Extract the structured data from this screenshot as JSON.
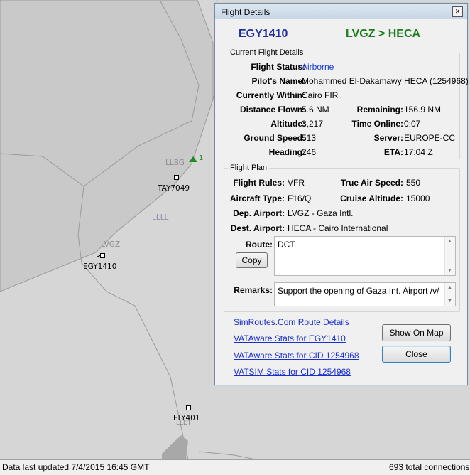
{
  "map": {
    "labels": {
      "llbg": "LLBG",
      "taycall": "TAY7049",
      "llll": "LLLL",
      "lvgz": "LVGZ",
      "egycall": "EGY1410",
      "elycall": "ELY401",
      "llet": "LLET",
      "traffic_count": "1"
    },
    "colors": {
      "land": "#c9c9c9",
      "sea": "#d7d7d7",
      "fir_line": "#9a9a9a",
      "traffic": "#1f8a1f"
    }
  },
  "dialog": {
    "title": "Flight Details",
    "close_glyph": "✕",
    "callsign": "EGY1410",
    "route": "LVGZ > HECA",
    "current": {
      "legend": "Current Flight Details",
      "status_label": "Flight Status:",
      "status_value": "Airborne",
      "pilot_label": "Pilot's Name:",
      "pilot_value": "Mohammed El-Dakamawy HECA (1254968)",
      "within_label": "Currently Within:",
      "within_value": "Cairo FIR",
      "dist_label": "Distance Flown:",
      "dist_value": "5.6 NM",
      "remain_label": "Remaining:",
      "remain_value": "156.9 NM",
      "alt_label": "Altitude:",
      "alt_value": "3,217",
      "online_label": "Time Online:",
      "online_value": "0:07",
      "gs_label": "Ground Speed:",
      "gs_value": "513",
      "server_label": "Server:",
      "server_value": "EUROPE-CC",
      "hdg_label": "Heading:",
      "hdg_value": "246",
      "eta_label": "ETA:",
      "eta_value": "17:04 Z"
    },
    "plan": {
      "legend": "Flight Plan",
      "rules_label": "Flight Rules:",
      "rules_value": "VFR",
      "tas_label": "True Air Speed:",
      "tas_value": "550",
      "type_label": "Aircraft Type:",
      "type_value": "F16/Q",
      "cruise_label": "Cruise Altitude:",
      "cruise_value": "15000",
      "dep_label": "Dep. Airport:",
      "dep_value": "LVGZ - Gaza Intl.",
      "dest_label": "Dest. Airport:",
      "dest_value": "HECA - Cairo International",
      "route_label": "Route:",
      "route_value": "DCT",
      "copy_label": "Copy",
      "remarks_label": "Remarks:",
      "remarks_value": "Support the opening of Gaza Int. Airport /v/"
    },
    "links": {
      "simroutes": "SimRoutes.Com Route Details",
      "vataware_callsign": "VATAware Stats for EGY1410",
      "vataware_cid": "VATAware Stats for CID 1254968",
      "vatsim_cid": "VATSIM Stats for CID 1254968"
    },
    "buttons": {
      "show_on_map": "Show On Map",
      "close": "Close"
    }
  },
  "status_bar": {
    "left": "Data last updated 7/4/2015 16:45 GMT",
    "right": "693 total connections"
  }
}
